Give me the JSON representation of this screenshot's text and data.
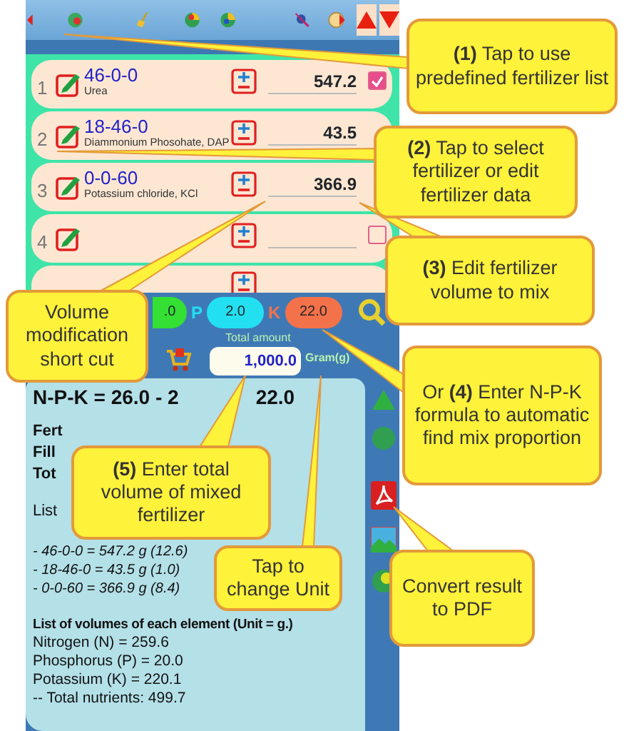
{
  "rows": [
    {
      "kind": "row",
      "number": "1",
      "formula": "46-0-0",
      "name": "Urea",
      "amount": "547.2",
      "checked": true
    },
    {
      "kind": "row",
      "number": "2",
      "formula": "18-46-0",
      "name": "Diammonium Phosohate, DAP",
      "amount": "43.5"
    },
    {
      "kind": "row",
      "number": "3",
      "formula": "0-0-60",
      "name": "Potassium chloride, KCl",
      "amount": "366.9"
    },
    {
      "kind": "row",
      "number": "4",
      "checked": false
    },
    {
      "kind": "partial"
    }
  ],
  "npk": [
    {
      "value": ".0",
      "color": "#33e033"
    },
    {
      "label": "P",
      "value": "2.0",
      "color": "#22e0f0"
    },
    {
      "label": "K",
      "value": "22.0",
      "color": "#f4724a"
    }
  ],
  "total": {
    "label": "Total amount",
    "value": "1,000.0",
    "unit": "Gram(g)"
  },
  "result": {
    "heading": [
      "N-P-K = 26.0 - 2",
      "22.0"
    ],
    "summary": [
      "Fert",
      "Fill",
      "Tot"
    ],
    "list_title": "List",
    "items": [
      "- 46-0-0 = 547.2 g (12.6)",
      "- 18-46-0 = 43.5 g (1.0)",
      "- 0-0-60 = 366.9 g (8.4)"
    ],
    "elements_title": "List of volumes of each element (Unit = g.)",
    "elements": [
      "Nitrogen (N) = 259.6",
      "Phosphorus (P) = 20.0",
      "Potassium (K) = 220.1",
      "-- Total nutrients: 499.7"
    ]
  },
  "callouts": [
    {
      "text": "**(1)** Tap to use predefined fertilizer list"
    },
    {
      "text": "**(2)** Tap to select fertilizer or edit fertilizer data"
    },
    {
      "text": "**(3)** Edit fertilizer volume to mix"
    },
    {
      "text": "Volume modification short cut"
    },
    {
      "text": "Or **(4)** Enter N-P-K formula to automatic find mix proportion"
    },
    {
      "text": "**(5)** Enter total volume of mixed fertilizer"
    },
    {
      "text": "Convert result to PDF"
    },
    {
      "text": "Tap to change Unit"
    }
  ]
}
